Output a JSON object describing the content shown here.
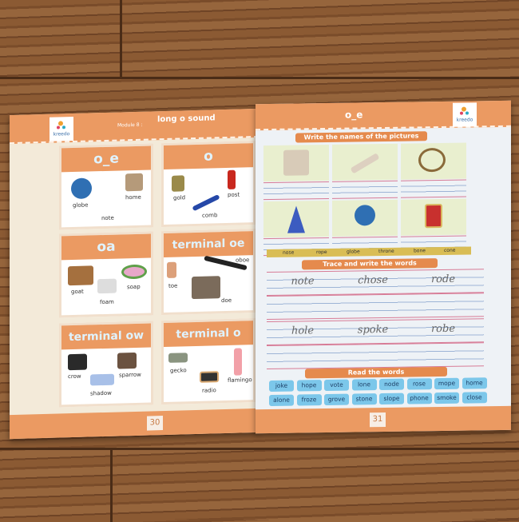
{
  "left_page": {
    "module": "Module 8 :",
    "title": "long o sound",
    "logo": "kreedo",
    "page_number": "30",
    "cards": [
      {
        "heading": "o_e",
        "words": [
          "globe",
          "home",
          "note"
        ]
      },
      {
        "heading": "o",
        "words": [
          "gold",
          "post",
          "comb"
        ]
      },
      {
        "heading": "oa",
        "words": [
          "goat",
          "soap",
          "foam"
        ]
      },
      {
        "heading": "terminal oe",
        "words": [
          "oboe",
          "toe",
          "doe"
        ]
      },
      {
        "heading": "terminal ow",
        "words": [
          "crow",
          "sparrow",
          "shadow"
        ]
      },
      {
        "heading": "terminal o",
        "words": [
          "gecko",
          "flamingo",
          "radio"
        ]
      }
    ]
  },
  "right_page": {
    "title": "o_e",
    "logo": "kreedo",
    "page_number": "31",
    "write_heading": "Write the names of the pictures",
    "word_bank": [
      "nose",
      "rope",
      "globe",
      "throne",
      "bone",
      "cone"
    ],
    "trace_heading": "Trace and write the words",
    "trace_words": [
      "note",
      "chose",
      "rode",
      "hole",
      "spoke",
      "robe"
    ],
    "read_heading": "Read the words",
    "read_words": [
      "joke",
      "hope",
      "vote",
      "lone",
      "node",
      "rose",
      "mope",
      "home",
      "alone",
      "froze",
      "grove",
      "stone",
      "slope",
      "phone",
      "smoke",
      "close"
    ]
  }
}
